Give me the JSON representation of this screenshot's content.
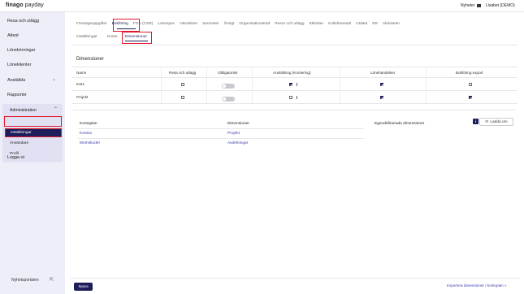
{
  "header": {
    "brand": "finago",
    "product": " payday",
    "news_label": "Nyheter",
    "user_label": "Lisabet (DEMO)"
  },
  "sidebar": {
    "items": [
      {
        "label": "Resa och utlägg"
      },
      {
        "label": "Attest"
      },
      {
        "label": "Lönekörningar"
      },
      {
        "label": "Löneklienter"
      },
      {
        "label": "Anställda"
      },
      {
        "label": "Rapporter"
      }
    ],
    "admin": {
      "label": "Administration",
      "subitems": [
        {
          "label": "Inställningar",
          "active": true
        },
        {
          "label": "Användare"
        },
        {
          "label": "Profil"
        }
      ]
    },
    "logout_label": "Logga ut",
    "portal_label": "Nyhetsportalen"
  },
  "tabs_primary": [
    "Företagsuppgifter",
    "Bokföring",
    "FOS (CSR)",
    "Lönespec",
    "Händelser",
    "Semester",
    "Övrigt",
    "Organisationsträd",
    "Resor och utlägg",
    "Etiketter",
    "Kollektivavtal",
    "Utdata",
    "ER",
    "Aktiviteter"
  ],
  "tabs_secondary": [
    "Inställningar",
    "Konto",
    "Dimensioner"
  ],
  "section_title": "Dimensioner",
  "table": {
    "columns": [
      "Namn",
      "Resa och utlägg",
      "Obligatorisk",
      "Anställning (Kontering)",
      "Lönehändelser",
      "Bokföring export"
    ],
    "rows": [
      {
        "name": "test1",
        "resa": false,
        "obligatorisk": false,
        "anstallning": true,
        "lonehandelser": true,
        "export": false
      },
      {
        "name": "Projekt",
        "resa": false,
        "obligatorisk": false,
        "anstallning": false,
        "lonehandelser": true,
        "export": true
      }
    ]
  },
  "mapping": {
    "col1_header": "Kontoplan",
    "col2_header": "Dimensioner",
    "col3_header": "Egendefinerade dimensioner",
    "rows": [
      {
        "kontoplan": "Konton",
        "dimension": "Projekt"
      },
      {
        "kontoplan": "Momskoder",
        "dimension": "Avdelningar"
      }
    ],
    "info_label": "i",
    "reload_label": "Ladda om"
  },
  "footer": {
    "save_label": "Spara",
    "import_label": "Importera dimensioner / kontoplan »"
  },
  "colors": {
    "accent": "#1d1d5b",
    "highlight": "#e0182b",
    "link": "#3b3bb0",
    "sidebar_bg": "#eeeef9"
  }
}
